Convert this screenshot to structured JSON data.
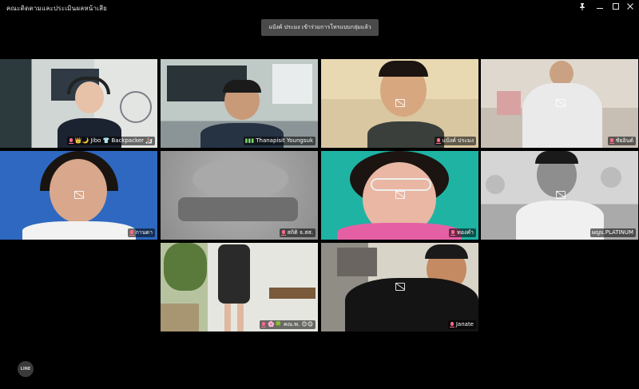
{
  "window": {
    "title": "คณะติดตามและประเมินผลหน้าเสีย",
    "controls": [
      "pin-icon",
      "minimize-icon",
      "maximize-icon",
      "close-icon"
    ]
  },
  "notification": "แบ้งค์ ประมง เข้าร่วมการโทรแบบกลุ่มแล้ว",
  "tiles": [
    {
      "name": "👑🌙 Jibo 👕 Backpacker 🏂"
    },
    {
      "name": "Thanapisit Youngsuk"
    },
    {
      "name": "แบ้งค์ ประมง"
    },
    {
      "name": "ชัยอินต์"
    },
    {
      "name": "กานดา"
    },
    {
      "name": "สถิติ จ.สส."
    },
    {
      "name": "ทองคำ"
    },
    {
      "name": "ผญบ.PLATINUM"
    },
    {
      "name": "🌸🍀 คณ.พ. 😊😋"
    },
    {
      "name": "Janate"
    }
  ],
  "app_logo": "LINE",
  "colors": {
    "active_border": "#7fd36a",
    "background": "#000000",
    "mic_muted": "#ff6b8a"
  }
}
